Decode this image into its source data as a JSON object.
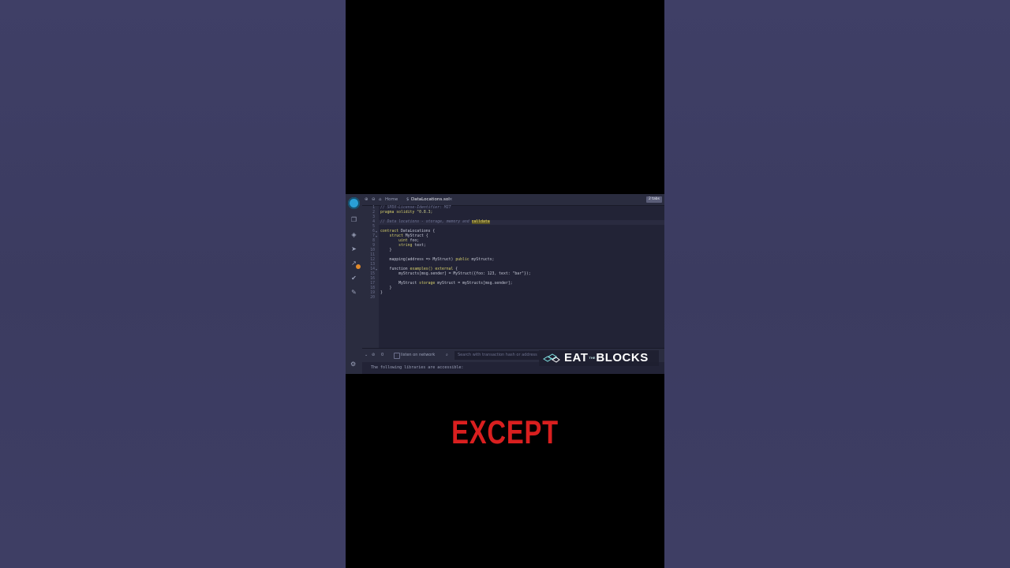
{
  "ide": {
    "tabs": {
      "home": "Home",
      "file": "DataLocations.sol"
    },
    "layout_button": "2 tabs",
    "lines": [
      "1",
      "2",
      "3",
      "4",
      "5",
      "6",
      "7",
      "8",
      "9",
      "10",
      "11",
      "12",
      "13",
      "14",
      "15",
      "16",
      "17",
      "18",
      "19",
      "20"
    ],
    "code": {
      "l1": "// SPDX-License-Identifier: MIT",
      "l2_kw": "pragma solidity",
      "l2_str": " ^0.8.3;",
      "l4_cmt": "// Data locations - storage, memory and ",
      "l4_hl": "calldata",
      "l6_kw": "contract",
      "l6_rest": " DataLocations {",
      "l7_kw": "    struct",
      "l7_rest": " MyStruct {",
      "l8_kw": "        uint",
      "l8_rest": " foo;",
      "l9_kw": "        string",
      "l9_rest": " text;",
      "l10": "    }",
      "l12_a": "    mapping(address => MyStruct) ",
      "l12_kw": "public",
      "l12_b": " myStructs;",
      "l14_a": "    function",
      "l14_b": " examples() ",
      "l14_kw": "external",
      "l14_c": " {",
      "l15": "        myStructs[msg.sender] = MyStruct({foo: 123, text: \"bar\"});",
      "l17_a": "        MyStruct ",
      "l17_kw": "storage",
      "l17_b": " myStruct = myStructs[msg.sender];",
      "l18": "    }",
      "l19": "}"
    },
    "terminal": {
      "count": "0",
      "listen_label": "listen on network",
      "search_placeholder": "Search with transaction hash or address",
      "output": "The following libraries are accessible:"
    }
  },
  "brand": {
    "word1": "EAT",
    "small": "THE",
    "word2": "BLOCKS"
  },
  "caption": "EXCEPT",
  "colors": {
    "accent": "#2a9fd6",
    "caption": "#d91f1f",
    "ide_bg": "#222336"
  },
  "icons": [
    "file-explorer-icon",
    "search-icon",
    "solidity-compiler-icon",
    "deploy-icon",
    "analytics-icon",
    "unit-test-icon",
    "plugin-icon",
    "settings-icon"
  ]
}
